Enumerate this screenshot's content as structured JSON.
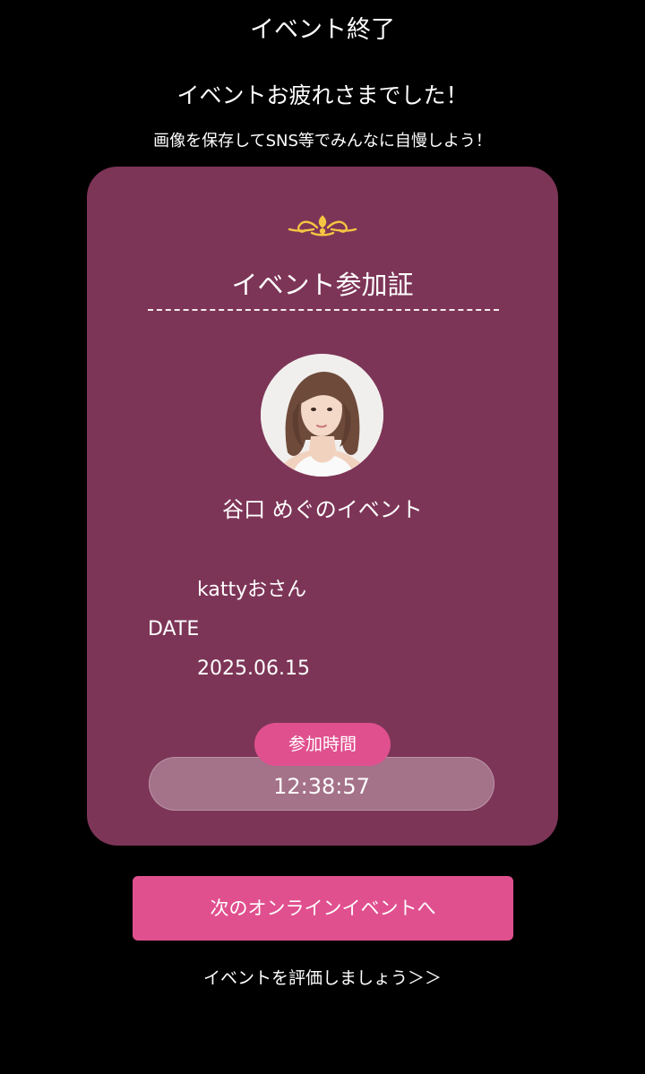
{
  "header": {
    "title": "イベント終了"
  },
  "message": {
    "thanks": "イベントお疲れさまでした！",
    "share_note": "画像を保存してSNS等でみんなに自慢しよう！"
  },
  "card": {
    "title": "イベント参加証",
    "host_name": "谷口 めぐのイベント",
    "username": "kattyおさん",
    "date_label": "DATE",
    "date_value": "2025.06.15",
    "time_badge": "参加時間",
    "time_value": "12:38:57",
    "ornament_icon": "ornament-icon",
    "ornament_color": "#f5c542",
    "background_color": "#7d3557"
  },
  "actions": {
    "next_event_label": "次のオンラインイベントへ",
    "rate_link_label": "イベントを評価しましょう＞＞",
    "accent_color": "#e0508f"
  }
}
